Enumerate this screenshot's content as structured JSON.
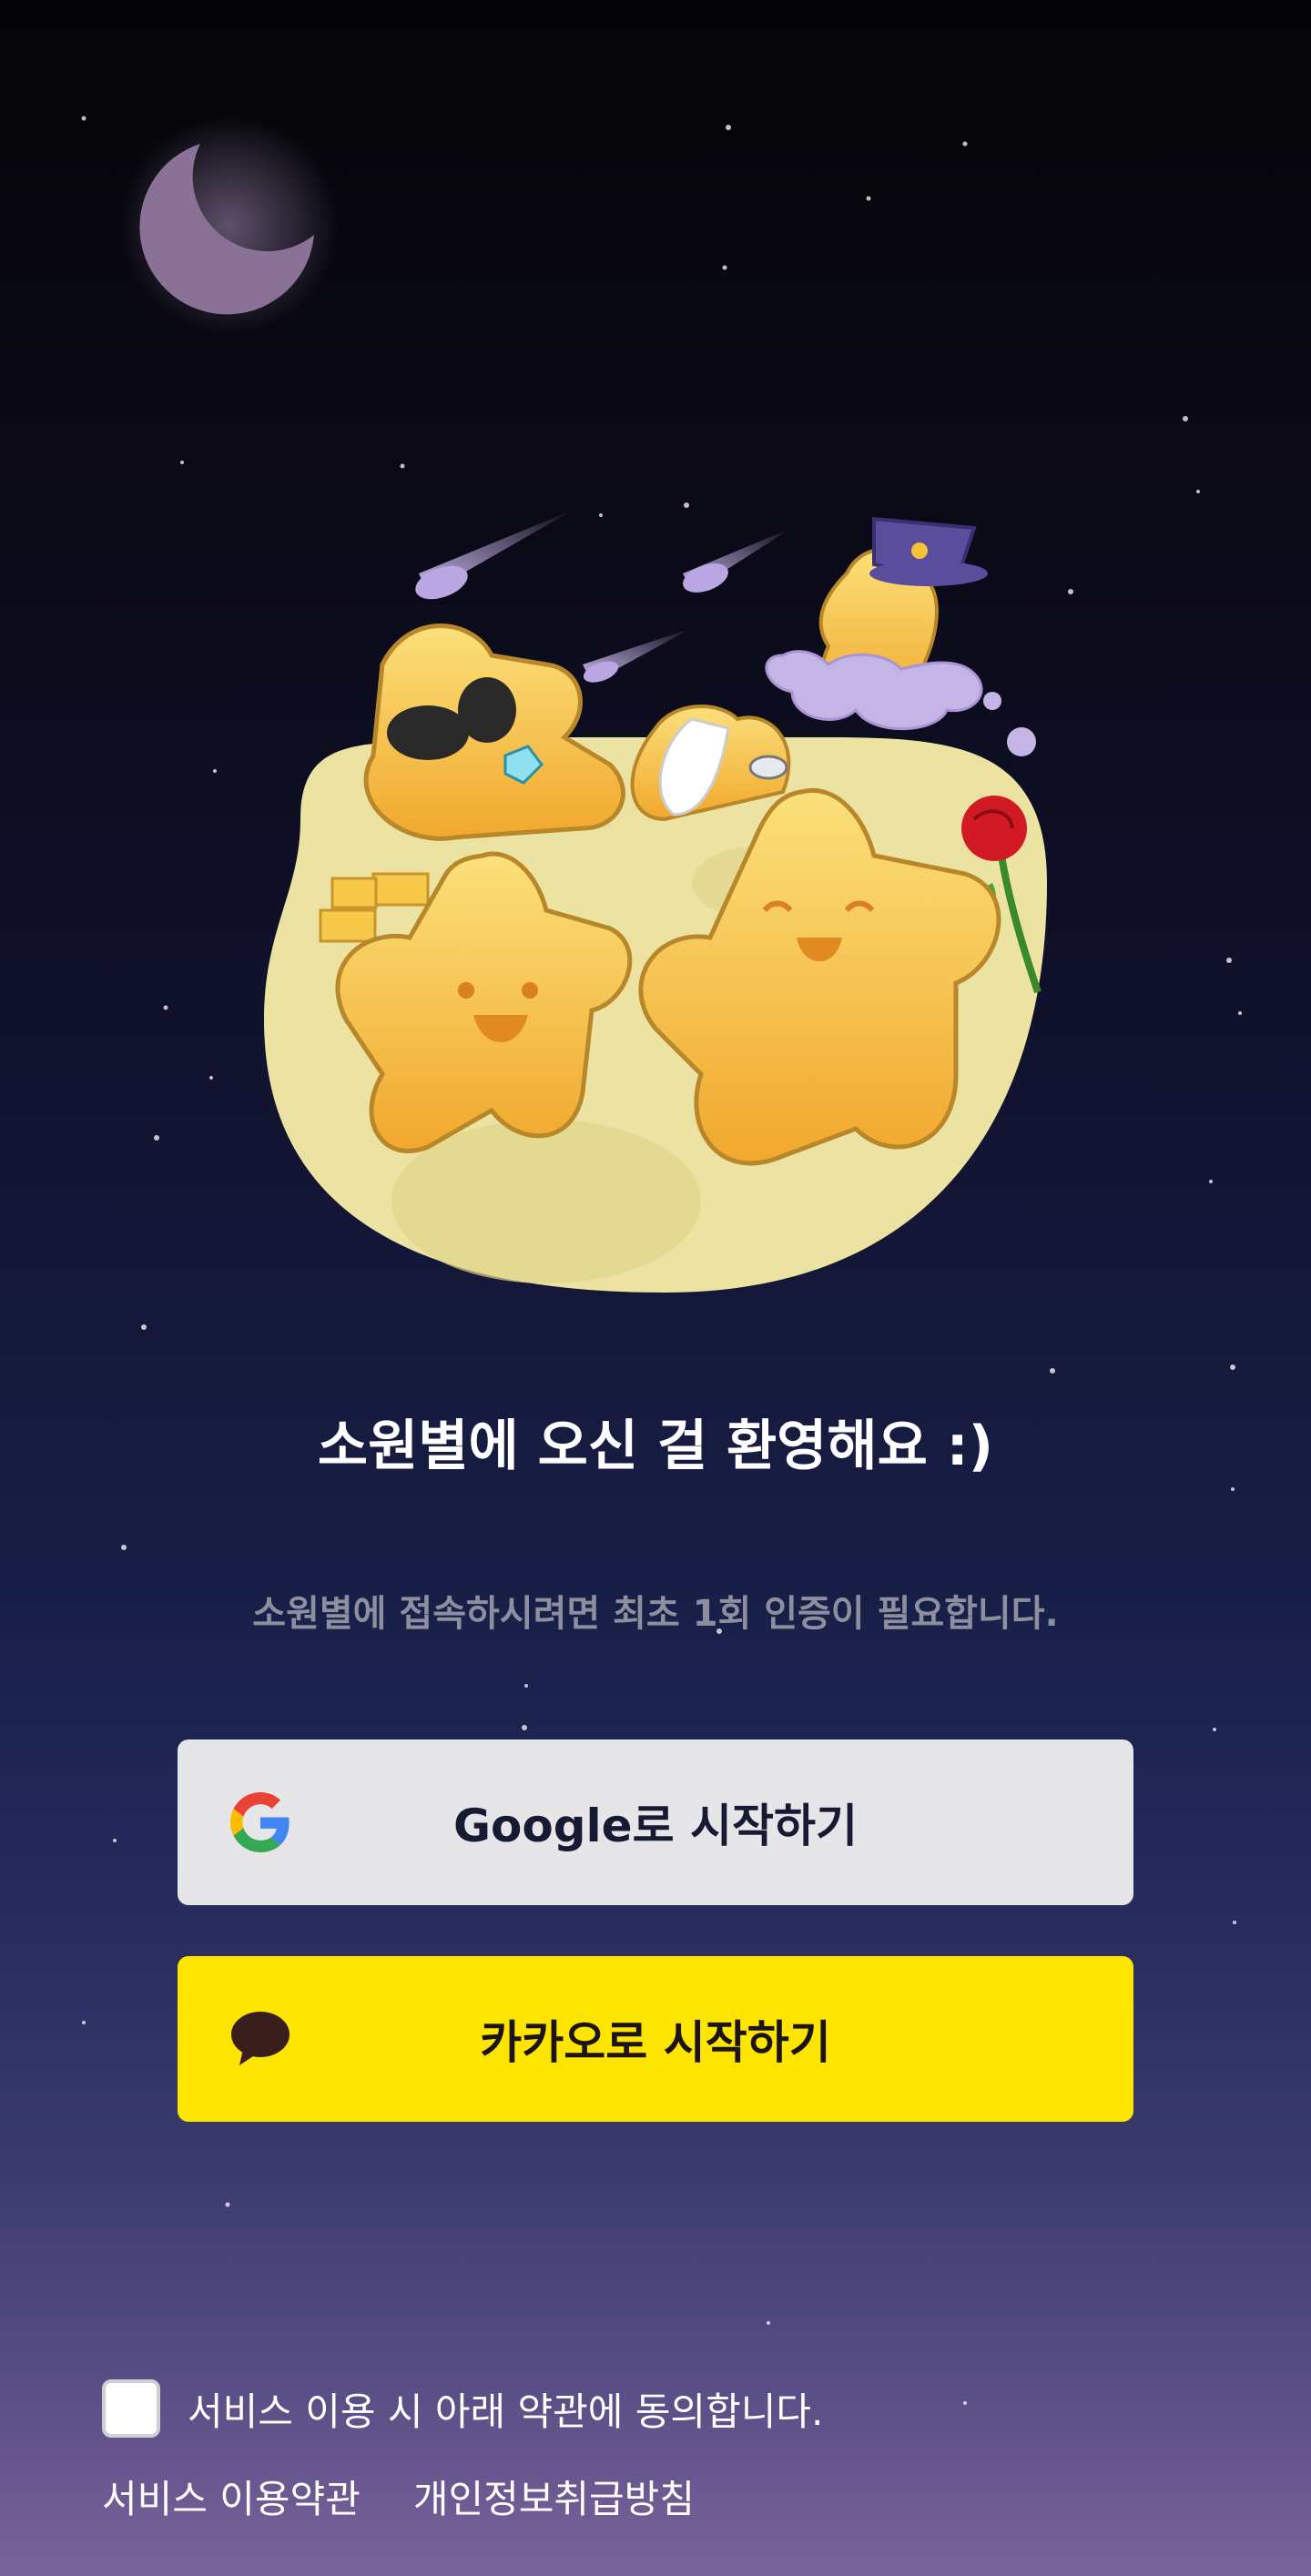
{
  "welcome": {
    "title": "소원별에 오신 걸 환영해요 :)",
    "subtitle": "소원별에 접속하시려면 최초 1회 인증이 필요합니다."
  },
  "buttons": {
    "google_label": "Google로 시작하기",
    "kakao_label": "카카오로 시작하기",
    "google_icon": "google-logo-icon",
    "kakao_icon": "kakao-speech-bubble-icon"
  },
  "consent": {
    "checked": false,
    "text": "서비스 이용 시 아래 약관에 동의합니다."
  },
  "links": {
    "terms": "서비스 이용약관",
    "privacy": "개인정보취급방침"
  },
  "colors": {
    "kakao_yellow": "#fee500",
    "google_button": "#e6e6e9",
    "background_top": "#050507",
    "background_bottom": "#7a639b"
  }
}
